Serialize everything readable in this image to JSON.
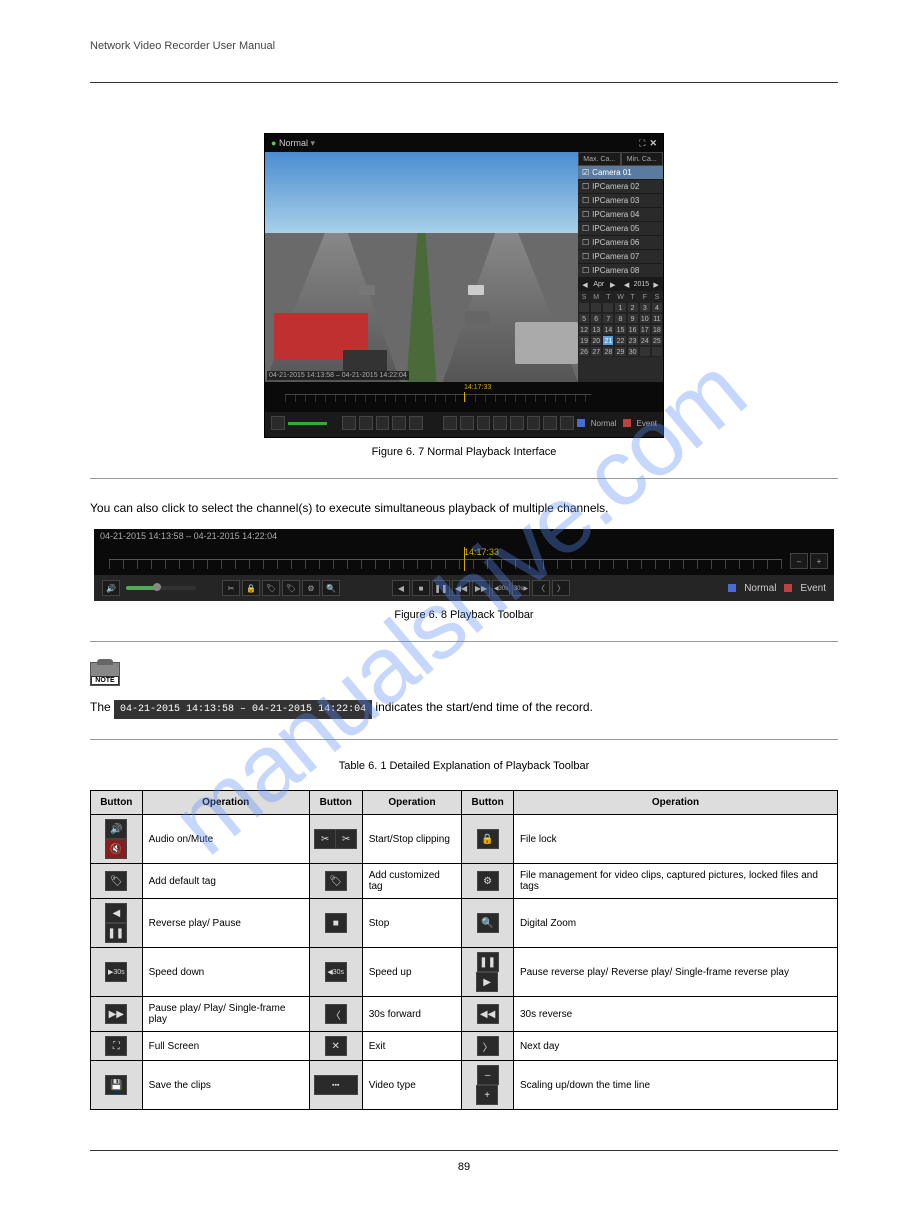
{
  "header_title": "Network Video Recorder User Manual",
  "page_number": "89",
  "watermark": "manualshive.com",
  "captions": {
    "fig1": "Figure 6. 7 Normal Playback Interface",
    "fig2": "Figure 6. 8 Playback Toolbar",
    "table": "Table 6. 1 Detailed Explanation of Playback Toolbar"
  },
  "body": {
    "toolbar_intro": "You can also click to select the channel(s) to execute simultaneous playback of multiple channels.",
    "note_line1": "The",
    "note_line2": "indicates the start/end time of the record."
  },
  "screenshot1": {
    "title": "Normal",
    "tab1": "Max. Ca...",
    "tab2": "Min. Ca...",
    "cameras": [
      "Camera 01",
      "IPCamera 02",
      "IPCamera 03",
      "IPCamera 04",
      "IPCamera 05",
      "IPCamera 06",
      "IPCamera 07",
      "IPCamera 08"
    ],
    "month": "Apr",
    "year": "2015",
    "days": [
      "S",
      "M",
      "T",
      "W",
      "T",
      "F",
      "S"
    ],
    "dates": [
      [
        "",
        "",
        "",
        "1",
        "2",
        "3",
        "4"
      ],
      [
        "5",
        "6",
        "7",
        "8",
        "9",
        "10",
        "11"
      ],
      [
        "12",
        "13",
        "14",
        "15",
        "16",
        "17",
        "18"
      ],
      [
        "19",
        "20",
        "21",
        "22",
        "23",
        "24",
        "25"
      ],
      [
        "26",
        "27",
        "28",
        "29",
        "30",
        "",
        ""
      ]
    ],
    "today": "21",
    "video_ts": "04-21-2015 14:13:58 – 04-21-2015 14:22:04",
    "timeline_time": "14:17:33",
    "legend_normal": "Normal",
    "legend_event": "Event"
  },
  "toolbar": {
    "range": "04-21-2015 14:13:58 – 04-21-2015 14:22:04",
    "time": "14:17:33",
    "legend_normal": "Normal",
    "legend_event": "Event"
  },
  "badge": "04-21-2015 14:13:58 – 04-21-2015 14:22:04",
  "table": {
    "h1": "Button",
    "h2": "Operation",
    "h3": "Button",
    "h4": "Operation",
    "h5": "Button",
    "h6": "Operation",
    "r1": {
      "c2": "Audio on/Mute",
      "c4": "Start/Stop clipping",
      "c6": "File lock"
    },
    "r2": {
      "c2": "Add default tag",
      "c4": "Add customized tag",
      "c6": "File management for video clips, captured pictures, locked files and tags"
    },
    "r3": {
      "c2": "Reverse play/ Pause",
      "c4": "Stop",
      "c6": "Digital Zoom"
    },
    "r4": {
      "c2": "Speed down",
      "c4": "Speed up",
      "c6": "Pause reverse play/ Reverse play/ Single-frame reverse play"
    },
    "r5": {
      "c2": "Pause play/ Play/ Single-frame play",
      "c4": "30s forward",
      "c6": "30s reverse"
    },
    "r6": {
      "c2": "Full Screen",
      "c4": "Exit",
      "c6": "Next day"
    },
    "r7": {
      "c2": "Save the clips",
      "c4": "Video type",
      "c6": "Scaling up/down the time line"
    }
  },
  "colors": {
    "normal": "#4a6ad8",
    "event": "#c04040",
    "timeline": "#d4aa00"
  }
}
